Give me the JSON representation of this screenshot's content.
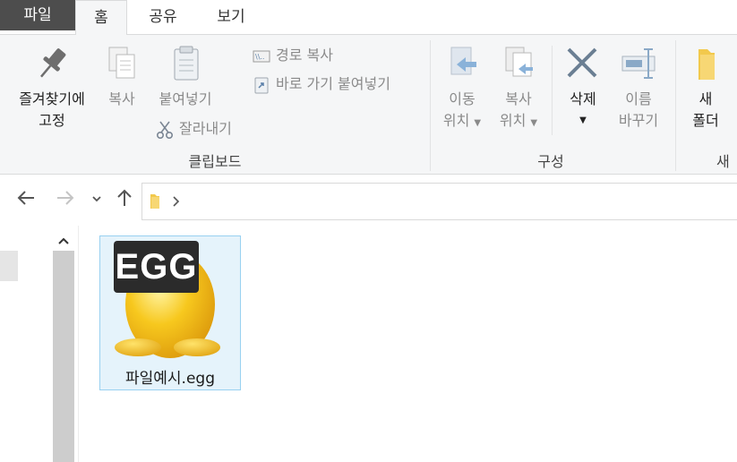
{
  "tabs": [
    {
      "label": "파일"
    },
    {
      "label": "홈"
    },
    {
      "label": "공유"
    },
    {
      "label": "보기"
    }
  ],
  "ribbon": {
    "clipboard": {
      "pin_line1": "즐겨찾기에",
      "pin_line2": "고정",
      "copy": "복사",
      "paste": "붙여넣기",
      "copy_path": "경로 복사",
      "paste_shortcut": "바로 가기 붙여넣기",
      "cut": "잘라내기",
      "group_label": "클립보드"
    },
    "organize": {
      "move_line1": "이동",
      "move_line2": "위치",
      "copyto_line1": "복사",
      "copyto_line2": "위치",
      "delete": "삭제",
      "rename_line1": "이름",
      "rename_line2": "바꾸기",
      "group_label": "구성"
    },
    "new": {
      "folder_line1": "새",
      "folder_line2": "폴더",
      "group_label": "새"
    }
  },
  "file": {
    "name": "파일예시.egg",
    "badge": "EGG"
  },
  "colors": {
    "file_tab": "#4d4d4d",
    "ribbon_bg": "#f5f6f7",
    "selection_bg": "#e5f3fb",
    "selection_border": "#99d1f0",
    "egg_yellow": "#f7c81e"
  }
}
